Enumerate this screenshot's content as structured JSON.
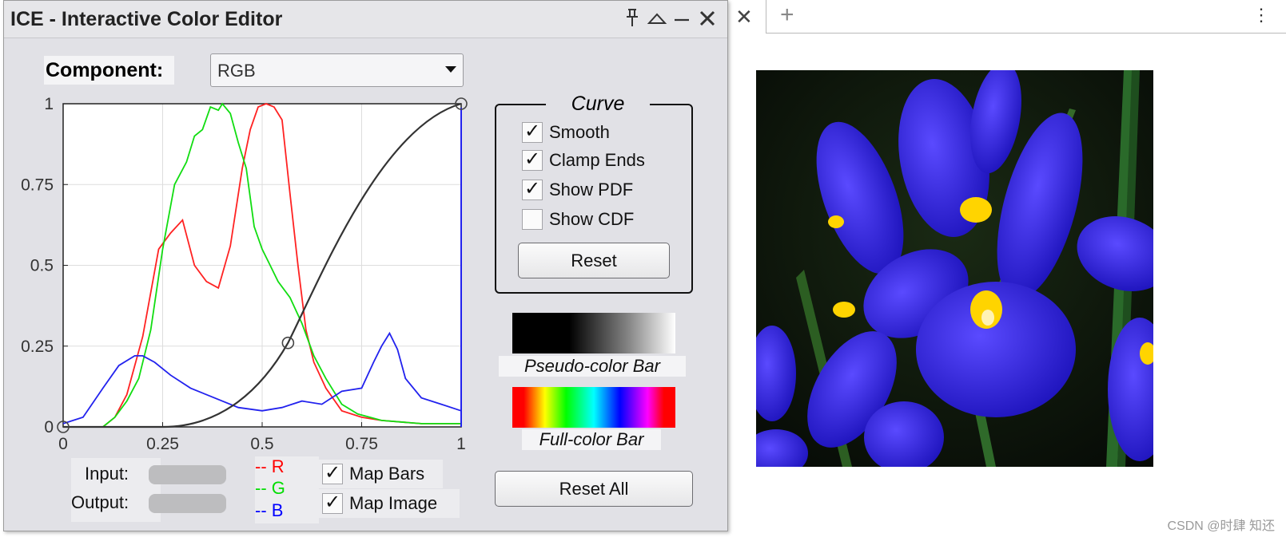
{
  "dialog": {
    "title": "ICE - Interactive Color Editor",
    "titlebar_buttons": [
      "pin-icon",
      "maximize-icon",
      "minimize-icon",
      "close-icon"
    ],
    "component": {
      "label": "Component:",
      "selected": "RGB"
    },
    "plot": {
      "y_ticks": [
        "1",
        "0.75",
        "0.5",
        "0.25",
        "0"
      ],
      "x_ticks": [
        "0",
        "0.25",
        "0.5",
        "0.75",
        "1"
      ]
    },
    "curve": {
      "title": "Curve",
      "options": [
        {
          "label": "Smooth",
          "checked": true
        },
        {
          "label": "Clamp Ends",
          "checked": true
        },
        {
          "label": "Show PDF",
          "checked": true
        },
        {
          "label": "Show CDF",
          "checked": false
        }
      ],
      "reset_label": "Reset"
    },
    "pseudo_color_bar_label": "Pseudo-color Bar",
    "full_color_bar_label": "Full-color Bar",
    "reset_all_label": "Reset All",
    "input_label": "Input:",
    "output_label": "Output:",
    "legend": [
      {
        "text": "-- R",
        "color": "#ff0000"
      },
      {
        "text": "-- G",
        "color": "#00dd00"
      },
      {
        "text": "-- B",
        "color": "#0000ff"
      }
    ],
    "map_bars": {
      "label": "Map Bars",
      "checked": true
    },
    "map_image": {
      "label": "Map Image",
      "checked": true
    }
  },
  "host": {
    "close_tab_glyph": "✕",
    "new_tab_glyph": "+",
    "more_glyph": "⋮",
    "watermark": "CSDN @时肆 知还"
  },
  "chart_data": {
    "type": "line",
    "xlim": [
      0,
      1
    ],
    "ylim": [
      0,
      1
    ],
    "grid": true,
    "x_ticks": [
      0,
      0.25,
      0.5,
      0.75,
      1
    ],
    "y_ticks": [
      0,
      0.25,
      0.5,
      0.75,
      1
    ],
    "series": [
      {
        "name": "R",
        "color": "#ff2222",
        "x": [
          0,
          0.1,
          0.13,
          0.16,
          0.2,
          0.24,
          0.27,
          0.3,
          0.33,
          0.36,
          0.39,
          0.42,
          0.45,
          0.47,
          0.49,
          0.51,
          0.53,
          0.55,
          0.57,
          0.59,
          0.61,
          0.63,
          0.66,
          0.7,
          0.75,
          0.8,
          0.9,
          1
        ],
        "y": [
          0,
          0,
          0.03,
          0.1,
          0.28,
          0.55,
          0.6,
          0.64,
          0.5,
          0.45,
          0.43,
          0.56,
          0.8,
          0.92,
          0.99,
          1,
          0.99,
          0.95,
          0.72,
          0.5,
          0.3,
          0.2,
          0.12,
          0.05,
          0.03,
          0.02,
          0.01,
          0.01
        ]
      },
      {
        "name": "G",
        "color": "#11dd11",
        "x": [
          0,
          0.1,
          0.13,
          0.16,
          0.19,
          0.22,
          0.25,
          0.28,
          0.31,
          0.33,
          0.35,
          0.37,
          0.39,
          0.4,
          0.42,
          0.44,
          0.46,
          0.48,
          0.5,
          0.52,
          0.54,
          0.57,
          0.6,
          0.63,
          0.66,
          0.7,
          0.74,
          0.8,
          0.9,
          1
        ],
        "y": [
          0,
          0,
          0.03,
          0.08,
          0.15,
          0.3,
          0.55,
          0.75,
          0.82,
          0.9,
          0.92,
          0.99,
          0.98,
          1,
          0.97,
          0.88,
          0.8,
          0.62,
          0.55,
          0.5,
          0.45,
          0.4,
          0.32,
          0.22,
          0.15,
          0.07,
          0.04,
          0.02,
          0.01,
          0.01
        ]
      },
      {
        "name": "B",
        "color": "#2222ee",
        "x": [
          0,
          0.05,
          0.1,
          0.14,
          0.18,
          0.2,
          0.23,
          0.27,
          0.32,
          0.38,
          0.44,
          0.5,
          0.55,
          0.6,
          0.65,
          0.7,
          0.75,
          0.78,
          0.8,
          0.82,
          0.84,
          0.86,
          0.9,
          0.95,
          1
        ],
        "y": [
          0.01,
          0.03,
          0.12,
          0.19,
          0.22,
          0.22,
          0.2,
          0.16,
          0.12,
          0.09,
          0.06,
          0.05,
          0.06,
          0.08,
          0.07,
          0.11,
          0.12,
          0.2,
          0.25,
          0.29,
          0.24,
          0.15,
          0.09,
          0.07,
          0.05
        ]
      },
      {
        "name": "mapping curve",
        "color": "#333333",
        "x": [
          0,
          0.25,
          0.57,
          1
        ],
        "y": [
          0,
          0,
          0.26,
          1
        ]
      }
    ],
    "control_points": [
      {
        "x": 0,
        "y": 0
      },
      {
        "x": 0.565,
        "y": 0.26
      },
      {
        "x": 1,
        "y": 1
      }
    ]
  }
}
